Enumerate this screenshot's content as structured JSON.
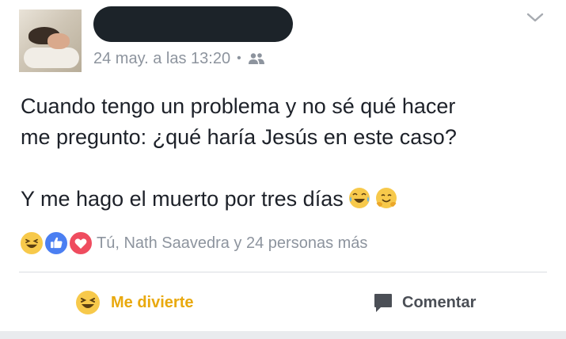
{
  "post": {
    "timestamp": "24 may. a las 13:20",
    "separator": "•",
    "audience_icon": "friends-icon",
    "text_lines": [
      "Cuando tengo un problema y no sé qué hacer",
      "me pregunto: ¿qué haría Jesús en este caso?",
      "Y me hago el muerto por tres días"
    ],
    "inline_emojis": [
      "crying-laughing-emoji",
      "hugging-emoji"
    ]
  },
  "reactions": {
    "icons": [
      "haha-reaction-icon",
      "like-reaction-icon",
      "love-reaction-icon"
    ],
    "summary": "Tú, Nath Saavedra y 24 personas más"
  },
  "actions": {
    "reaction_label": "Me divierte",
    "comment_label": "Comentar"
  },
  "colors": {
    "reaction_accent": "#e9a90e",
    "meta_gray": "#8d949e",
    "like_blue": "#4b7ff2",
    "love_red": "#ef4c5f",
    "haha_yellow": "#f7c94b"
  }
}
